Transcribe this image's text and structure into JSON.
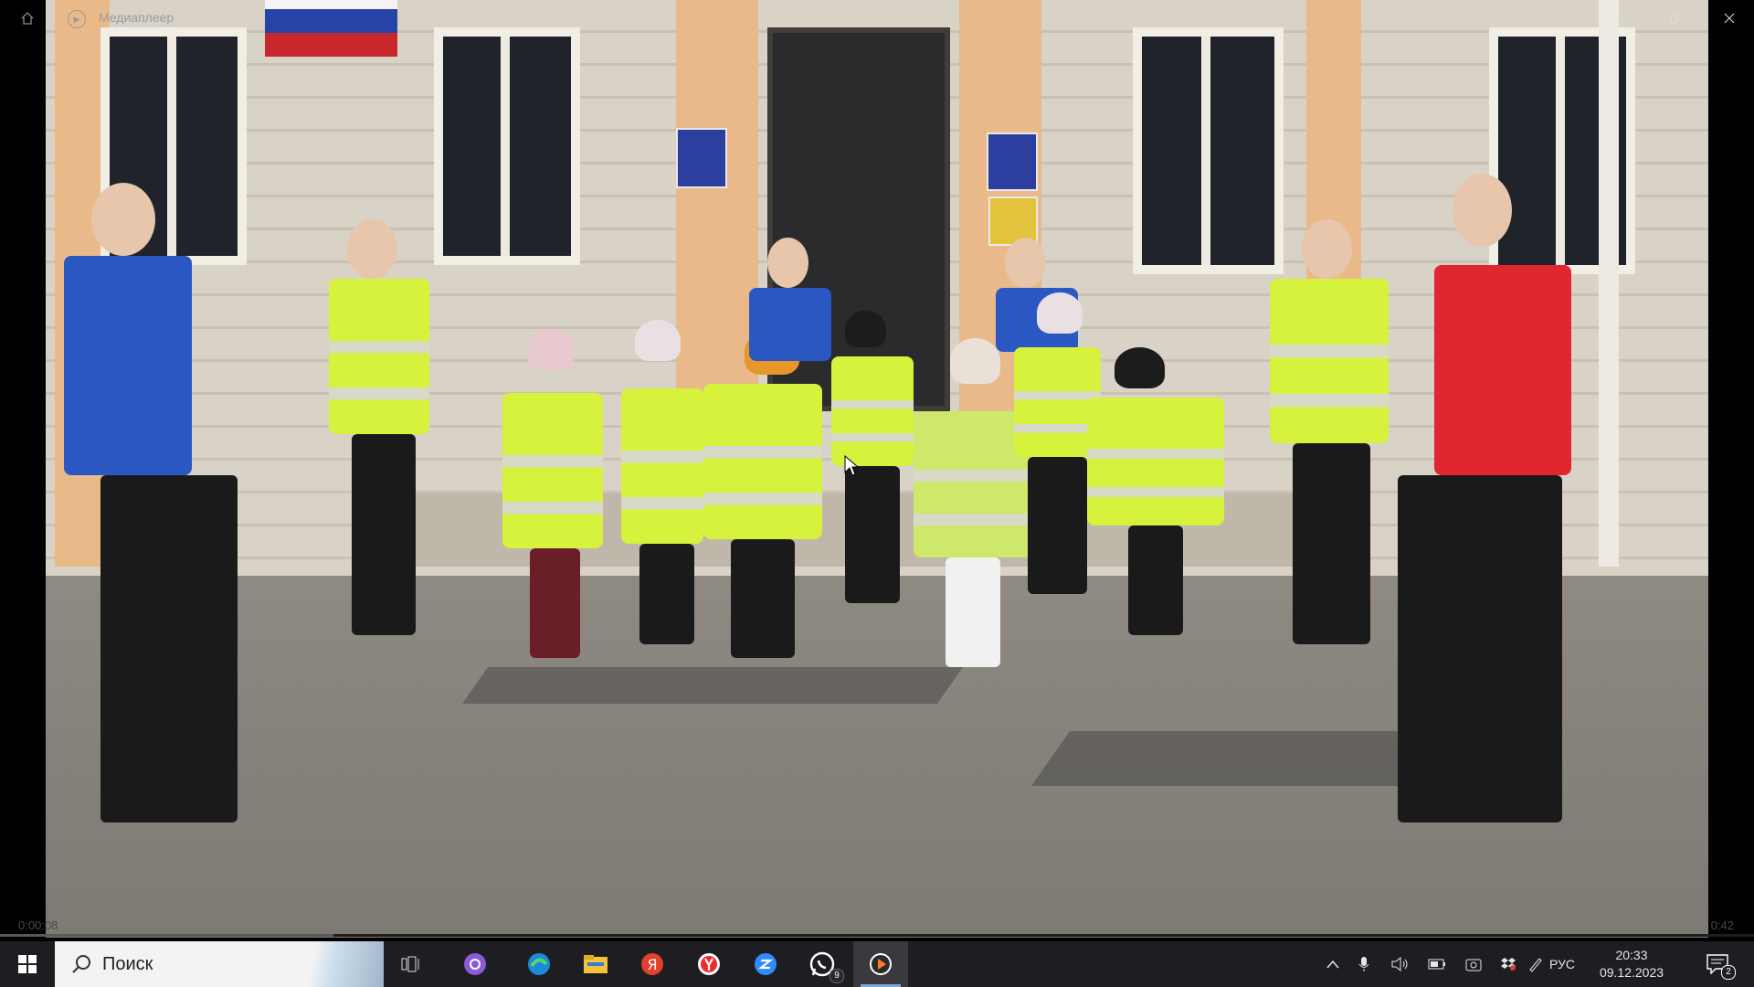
{
  "player": {
    "title": "Медиаплеер",
    "time_current": "0:00:08",
    "time_total": "0:42",
    "progress_fraction": 0.19
  },
  "taskbar": {
    "search_placeholder": "Поиск",
    "whatsapp_badge": "9",
    "language": "РУС",
    "time": "20:33",
    "date": "09.12.2023",
    "notification_count": "2"
  },
  "colors": {
    "taskbar_bg": "#1e1e22",
    "accent": "#7fa7d8",
    "vest": "#d6f23c"
  },
  "icons": [
    "home-icon",
    "minimize-icon",
    "maximize-icon",
    "close-icon",
    "windows-start-icon",
    "search-icon",
    "task-view-icon",
    "cortana-icon",
    "edge-icon",
    "file-explorer-icon",
    "yandex-browser-icon",
    "yandex-icon",
    "zoom-icon",
    "whatsapp-icon",
    "media-player-icon",
    "chevron-up-icon",
    "microphone-icon",
    "volume-icon",
    "battery-icon",
    "camera-icon",
    "dropbox-icon",
    "pen-icon",
    "notification-icon"
  ]
}
